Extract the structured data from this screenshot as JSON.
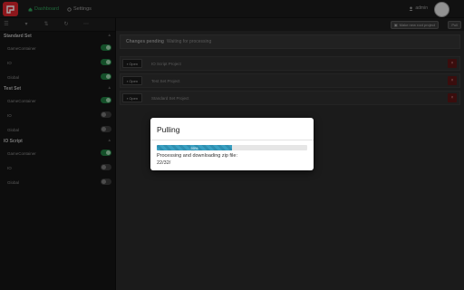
{
  "colors": {
    "accent_green": "#2f9e5a",
    "brand_red": "#d9242b",
    "progress_blue": "#3aa0c2"
  },
  "topbar": {
    "nav": [
      {
        "label": "Dashboard",
        "icon": "home-icon"
      },
      {
        "label": "Settings",
        "icon": "gear-icon"
      }
    ],
    "user_label": "admin",
    "user_icon": "user-icon"
  },
  "sidebar": {
    "groups": [
      {
        "title": "Standard Set",
        "items": [
          {
            "label": "GameContainer",
            "on": true
          },
          {
            "label": "IO",
            "on": true
          },
          {
            "label": "Global",
            "on": true
          }
        ]
      },
      {
        "title": "Test Set",
        "items": [
          {
            "label": "GameContainer",
            "on": true
          },
          {
            "label": "IO",
            "on": false
          },
          {
            "label": "Global",
            "on": false
          }
        ]
      },
      {
        "title": "IO Script",
        "items": [
          {
            "label": "GameContainer",
            "on": true
          },
          {
            "label": "IO",
            "on": false
          },
          {
            "label": "Global",
            "on": false
          }
        ]
      }
    ]
  },
  "main": {
    "new_button": "Make new root project",
    "pull_button": "Pull",
    "changes_label": "Changes pending",
    "changes_sub": "Waiting for processing",
    "projects": [
      {
        "open_label": "Open",
        "name": "IO Script Project"
      },
      {
        "open_label": "Open",
        "name": "Test Set Project"
      },
      {
        "open_label": "Open",
        "name": "Standard Set Project"
      }
    ]
  },
  "modal": {
    "title": "Pulling",
    "progress_percent": 50,
    "progress_label": "50%",
    "status_text": "Processing and downloading zip file:",
    "detail_text": "22/32/"
  }
}
